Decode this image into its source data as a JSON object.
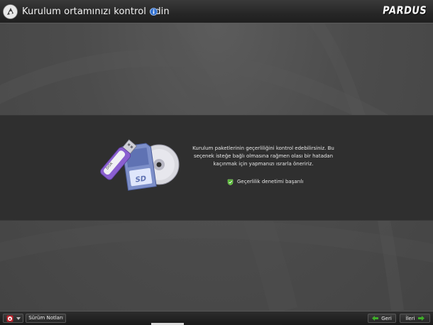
{
  "header": {
    "title": "Kurulum ortamınızı kontrol edin",
    "brand": "PARDUS",
    "app_logo_icon": "pardus-logo-icon",
    "help_icon": "info-help-icon"
  },
  "content": {
    "description": "Kurulum paketlerinin geçerliliğini kontrol edebilirsiniz. Bu seçenek isteğe bağlı olmasına rağmen olası bir hatadan kaçınmak için yapmanızı ısrarla öneririz.",
    "status_text": "Geçerlilik denetimi başarılı",
    "status_icon": "check-shield-icon",
    "illustration": {
      "usb_label": "DISK",
      "sd_label": "SD",
      "items": [
        "usb-stick",
        "sd-card",
        "optical-disc"
      ]
    }
  },
  "footer": {
    "menu_icon": "pardus-logo-icon",
    "release_notes_label": "Sürüm Notları",
    "back_label": "Geri",
    "next_label": "İleri",
    "progress_fraction": 0.25
  },
  "colors": {
    "header_bg": "#262626",
    "content_band": "#2f2f2f",
    "background": "#4a4a4a",
    "accent_green": "#3fae2a",
    "brand_red": "#c0202a"
  }
}
